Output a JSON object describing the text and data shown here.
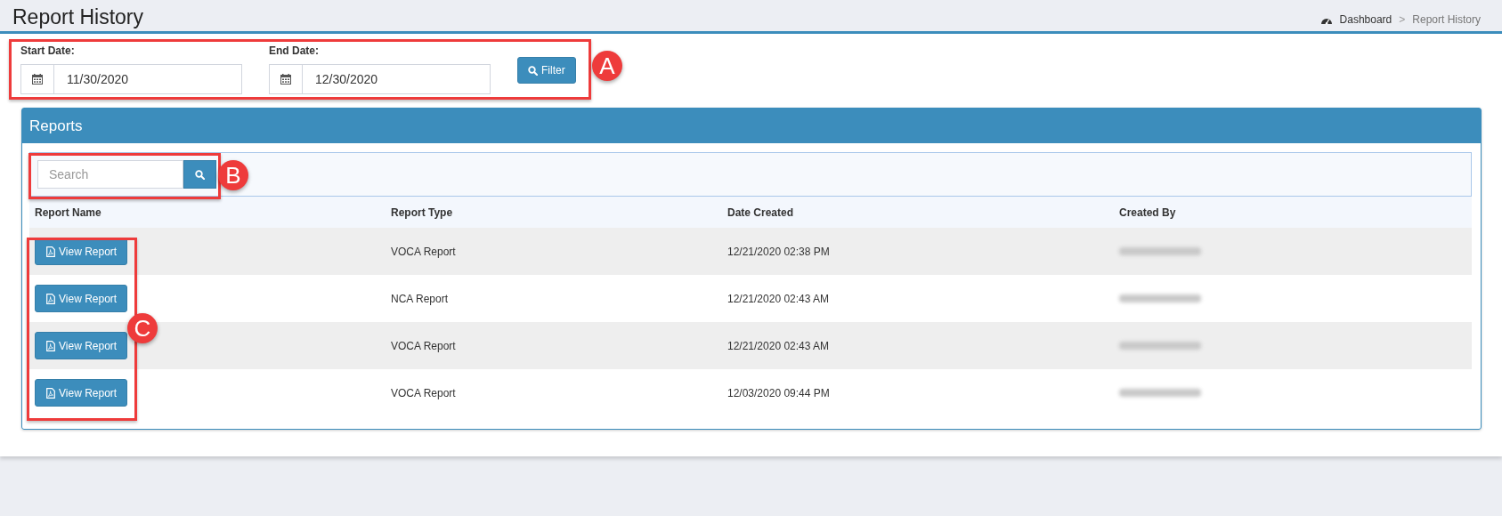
{
  "page_title": "Report History",
  "breadcrumbs": [
    {
      "label": "Dashboard",
      "kind": "home",
      "selected": false
    },
    {
      "label": "Report History",
      "kind": "current",
      "selected": true
    }
  ],
  "breadcrumb_separator": ">",
  "filter": {
    "start_label": "Start Date:",
    "start_value": "11/30/2020",
    "end_label": "End Date:",
    "end_value": "12/30/2020",
    "button": "Filter"
  },
  "panel": {
    "title": "Reports",
    "search": {
      "placeholder": "Search"
    },
    "table": {
      "columns": [
        "Report Name",
        "Report Type",
        "Date Created",
        "Created By"
      ],
      "rows": [
        {
          "action": "View Report",
          "type": "VOCA Report",
          "date": "12/21/2020 02:38 PM",
          "created_by_redacted": true
        },
        {
          "action": "View Report",
          "type": "NCA Report",
          "date": "12/21/2020 02:43 AM",
          "created_by_redacted": true
        },
        {
          "action": "View Report",
          "type": "VOCA Report",
          "date": "12/21/2020 02:43 AM",
          "created_by_redacted": true
        },
        {
          "action": "View Report",
          "type": "VOCA Report",
          "date": "12/03/2020 09:44 PM",
          "created_by_redacted": true
        }
      ]
    }
  },
  "annotations": [
    {
      "label": "A"
    },
    {
      "label": "B"
    },
    {
      "label": "C"
    }
  ]
}
